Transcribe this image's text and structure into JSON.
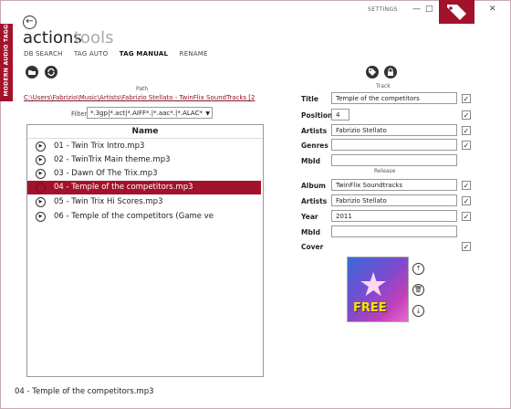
{
  "window": {
    "settings_label": "SETTINGS",
    "minimize_glyph": "—",
    "maximize_glyph": "□",
    "close_glyph": "✕"
  },
  "app": {
    "brand_label": "MODERN AUDIO TAGGER",
    "title_main": "actions",
    "title_sub": "tools",
    "back_glyph": "←"
  },
  "tabs": [
    {
      "label": "DB SEARCH",
      "active": false
    },
    {
      "label": "TAG AUTO",
      "active": false
    },
    {
      "label": "TAG MANUAL",
      "active": true
    },
    {
      "label": "RENAME",
      "active": false
    }
  ],
  "browser": {
    "path_label": "Path",
    "path_value": "C:\\Users\\Fabrizio\\Music\\Artists\\Fabrizio Stellato - TwinFlix SoundTracks [2",
    "filter_label": "Filter",
    "filter_value": "*.3gp|*.act|*.AIFF*.|*.aac*.|*.ALAC*",
    "list_header": "Name",
    "files": [
      "01 - Twin Trix Intro.mp3",
      "02 - TwinTrix Main theme.mp3",
      "03 - Dawn Of The Trix.mp3",
      "04 - Temple of the competitors.mp3",
      "05 - Twin Trix Hi Scores.mp3",
      "06 - Temple of the competitors (Game ve"
    ],
    "selected_index": 3
  },
  "status_text": "04 - Temple of the competitors.mp3",
  "tags": {
    "track_section": "Track",
    "release_section": "Release",
    "title_label": "Title",
    "title_value": "Temple of the competitors",
    "position_label": "Position",
    "position_value": "4",
    "artists_label": "Artists",
    "artists_value": "Fabrizio Stellato",
    "genres_label": "Genres",
    "genres_value": "",
    "mbid_label": "MbId",
    "mbid_value": "",
    "album_label": "Album",
    "album_value": "TwinFlix Soundtracks",
    "release_artists_label": "Artists",
    "release_artists_value": "Fabrizio Stellato",
    "year_label": "Year",
    "year_value": "2011",
    "release_mbid_label": "MbId",
    "release_mbid_value": "",
    "cover_label": "Cover",
    "cover_text": "FREE",
    "check_glyph": "✓"
  },
  "colors": {
    "accent": "#a3122b",
    "selection": "#a3122b"
  }
}
